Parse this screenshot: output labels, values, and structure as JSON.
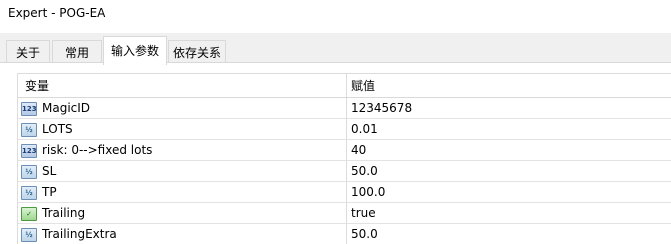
{
  "window": {
    "title": "Expert - POG-EA"
  },
  "tabs": [
    {
      "label": "关于"
    },
    {
      "label": "常用"
    },
    {
      "label": "输入参数"
    },
    {
      "label": "依存关系"
    }
  ],
  "table": {
    "headers": {
      "variable": "变量",
      "value": "赋值"
    },
    "rows": [
      {
        "icon": "integer-type-icon",
        "name": "MagicID",
        "value": "12345678"
      },
      {
        "icon": "double-type-icon",
        "name": "LOTS",
        "value": "0.01"
      },
      {
        "icon": "integer-type-icon",
        "name": "risk: 0-->fixed lots",
        "value": "40"
      },
      {
        "icon": "double-type-icon",
        "name": "SL",
        "value": "50.0"
      },
      {
        "icon": "double-type-icon",
        "name": "TP",
        "value": "100.0"
      },
      {
        "icon": "boolean-type-icon",
        "name": "Trailing",
        "value": "true"
      },
      {
        "icon": "double-type-icon",
        "name": "TrailingExtra",
        "value": "50.0"
      }
    ]
  }
}
